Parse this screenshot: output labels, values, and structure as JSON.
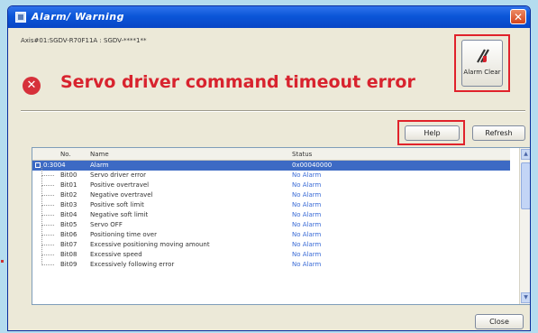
{
  "window": {
    "title": "Alarm/ Warning",
    "close_glyph": "✕"
  },
  "axis_info": "Axis#01:SGDV-R70F11A : SGDV-****1**",
  "error": {
    "icon": "error-x-icon",
    "icon_glyph": "✕",
    "message": "Servo driver command timeout error"
  },
  "buttons": {
    "alarm_clear": "Alarm Clear",
    "help": "Help",
    "refresh": "Refresh",
    "close": "Close"
  },
  "table": {
    "columns": [
      "No.",
      "Name",
      "Status"
    ],
    "rows": [
      {
        "no": "0:3004",
        "name": "Alarm",
        "status": "0x00040000",
        "selected": true
      },
      {
        "no": "Bit00",
        "name": "Servo driver error",
        "status": "No Alarm"
      },
      {
        "no": "Bit01",
        "name": "Positive overtravel",
        "status": "No Alarm"
      },
      {
        "no": "Bit02",
        "name": "Negative overtravel",
        "status": "No Alarm"
      },
      {
        "no": "Bit03",
        "name": "Positive soft limit",
        "status": "No Alarm"
      },
      {
        "no": "Bit04",
        "name": "Negative soft limit",
        "status": "No Alarm"
      },
      {
        "no": "Bit05",
        "name": "Servo OFF",
        "status": "No Alarm"
      },
      {
        "no": "Bit06",
        "name": "Positioning time over",
        "status": "No Alarm"
      },
      {
        "no": "Bit07",
        "name": "Excessive positioning moving amount",
        "status": "No Alarm"
      },
      {
        "no": "Bit08",
        "name": "Excessive speed",
        "status": "No Alarm"
      },
      {
        "no": "Bit09",
        "name": "Excessively following error",
        "status": "No Alarm"
      }
    ]
  },
  "colors": {
    "error_red": "#d8232e",
    "highlight_frame": "#e0222b",
    "selection": "#3d6ac4",
    "status_blue": "#3a6bd6"
  }
}
